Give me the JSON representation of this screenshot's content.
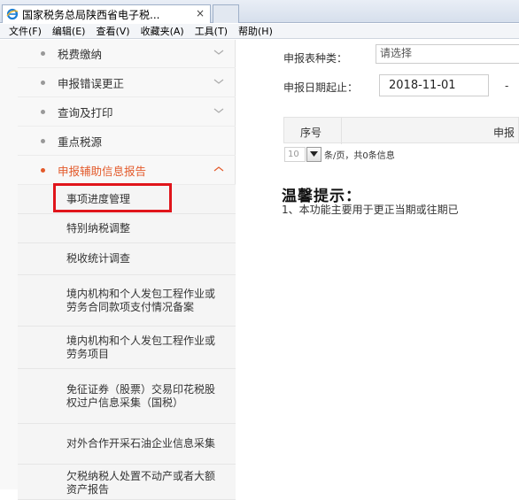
{
  "browser": {
    "tab_title": "国家税务总局陕西省电子税...",
    "tab_close": "×"
  },
  "menu": [
    "文件(F)",
    "编辑(E)",
    "查看(V)",
    "收藏夹(A)",
    "工具(T)",
    "帮助(H)"
  ],
  "sidebar": {
    "items": [
      {
        "label": "税费缴纳",
        "expanded": false
      },
      {
        "label": "申报错误更正",
        "expanded": false
      },
      {
        "label": "查询及打印",
        "expanded": false
      },
      {
        "label": "重点税源"
      },
      {
        "label": "申报辅助信息报告",
        "expanded": true,
        "active": true
      }
    ],
    "subitems": [
      "事项进度管理",
      "特别纳税调整",
      "税收统计调查",
      "境内机构和个人发包工程作业或劳务合同款项支付情况备案",
      "境内机构和个人发包工程作业或劳务项目",
      "免征证券（股票）交易印花税股权过户信息采集（国税）",
      "对外合作开采石油企业信息采集",
      "欠税纳税人处置不动产或者大额资产报告"
    ]
  },
  "form": {
    "type_label": "申报表种类：",
    "type_value": "请选择",
    "date_label": "申报日期起止：",
    "date_start": "2018-11-01",
    "date_sep": "-"
  },
  "table": {
    "headers": [
      "序号",
      "申报"
    ]
  },
  "pager": {
    "page_size": "10",
    "info": "条/页，共0条信息"
  },
  "tip": {
    "title": "温馨提示：",
    "text": "1、本功能主要用于更正当期或往期已"
  },
  "colors": {
    "active": "#e35a2b",
    "highlight_border": "#e0151b"
  }
}
